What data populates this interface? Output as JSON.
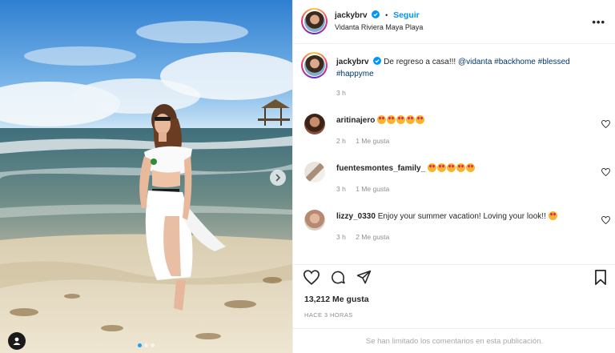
{
  "post": {
    "username": "jackybrv",
    "follow_label": "Seguir",
    "location": "Vidanta Riviera Maya Playa",
    "more_icon": "more-horizontal-icon",
    "caption_text": "De regreso a casa!!!",
    "caption_mention": "@vidanta",
    "caption_hashtags": [
      "#backhome",
      "#blessed",
      "#happyme"
    ],
    "caption_time": "3 h"
  },
  "comments": [
    {
      "username": "aritinajero",
      "text": "",
      "emoji_count": 5,
      "time": "2 h",
      "likes": "1 Me gusta"
    },
    {
      "username": "fuentesmontes_family_",
      "text": "",
      "emoji_count": 5,
      "time": "3 h",
      "likes": "1 Me gusta"
    },
    {
      "username": "lizzy_0330",
      "text": "Enjoy your summer vacation! Loving your look!!",
      "emoji_count": 1,
      "time": "3 h",
      "likes": "2 Me gusta"
    }
  ],
  "actions": {
    "like_icon": "heart-icon",
    "comment_icon": "comment-icon",
    "share_icon": "send-icon",
    "save_icon": "bookmark-icon"
  },
  "likes_count": "13,212 Me gusta",
  "posted_ago": "HACE 3 HORAS",
  "comments_limited": "Se han limitado los comentarios en esta publicación.",
  "colors": {
    "follow": "#0095f6",
    "hashtag": "#00376b",
    "verified": "#0095f6",
    "active_dot": "#1da1f2"
  }
}
